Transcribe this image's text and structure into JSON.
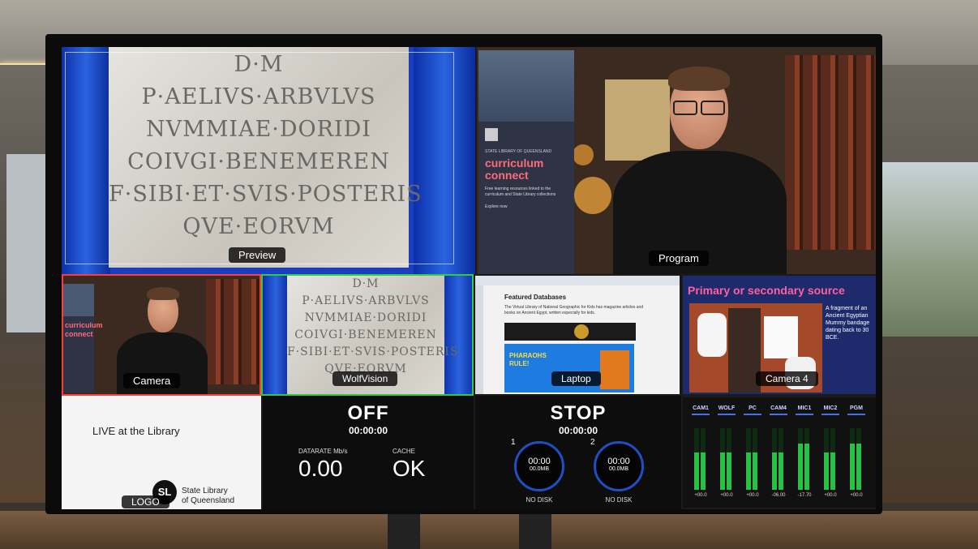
{
  "tiles": {
    "preview": "Preview",
    "program": "Program",
    "camera": "Camera",
    "wolfvision": "WolfVision",
    "laptop": "Laptop",
    "camera4": "Camera 4",
    "logo": "LOGO"
  },
  "tablet_lines": [
    "D·M",
    "P·AELIVS·ARBVLVS",
    "NVMMIAE·DORIDI",
    "COIVGI·BENEMEREN",
    "F·SIBI·ET·SVIS·POSTERIS",
    "QVE·EORVM"
  ],
  "banner": {
    "org": "STATE LIBRARY OF QUEENSLAND",
    "title1": "curriculum",
    "title2": "connect",
    "body": "Free learning resources linked to the curriculum and State Library collections",
    "explore": "Explore now"
  },
  "laptop": {
    "heading": "Featured Databases",
    "body": "The Virtual Library of National Geographic for Kids has magazine articles and books on Ancient Egypt, written especially for kids.",
    "poster1": "PHARAOHS",
    "poster2": "RULE!"
  },
  "camera4": {
    "heading": "Primary or secondary source",
    "caption": "A fragment of an Ancient Egyptian Mummy bandage dating back to 30 BCE."
  },
  "lower_third": {
    "text": "LIVE at the Library",
    "sl_badge": "SL",
    "org_line1": "State Library",
    "org_line2": "of Queensland"
  },
  "stream": {
    "status": "OFF",
    "time": "00:00:00",
    "datarate_label": "DATARATE Mb/s",
    "datarate_value": "0.00",
    "cache_label": "CACHE",
    "cache_value": "OK"
  },
  "record": {
    "status": "STOP",
    "time": "00:00:00",
    "disk1": {
      "num": "1",
      "time": "00:00",
      "size": "00.0MB",
      "note": "NO DISK"
    },
    "disk2": {
      "num": "2",
      "time": "00:00",
      "size": "00.0MB",
      "note": "NO DISK"
    }
  },
  "audio": [
    {
      "label": "CAM1",
      "level": 0.6,
      "value": "+00.0"
    },
    {
      "label": "WOLF",
      "level": 0.6,
      "value": "+00.0"
    },
    {
      "label": "PC",
      "level": 0.6,
      "value": "+00.0"
    },
    {
      "label": "CAM4",
      "level": 0.6,
      "value": "-06.00"
    },
    {
      "label": "MIC1",
      "level": 0.75,
      "value": "-17.70"
    },
    {
      "label": "MIC2",
      "level": 0.6,
      "value": "+00.0"
    },
    {
      "label": "PGM",
      "level": 0.75,
      "value": "+00.0"
    }
  ],
  "colors": {
    "preview_border": "#ff3b3b",
    "program_border": "#2ecc40",
    "meter_green": "#27c245",
    "dial_blue": "#1f4fc4"
  }
}
